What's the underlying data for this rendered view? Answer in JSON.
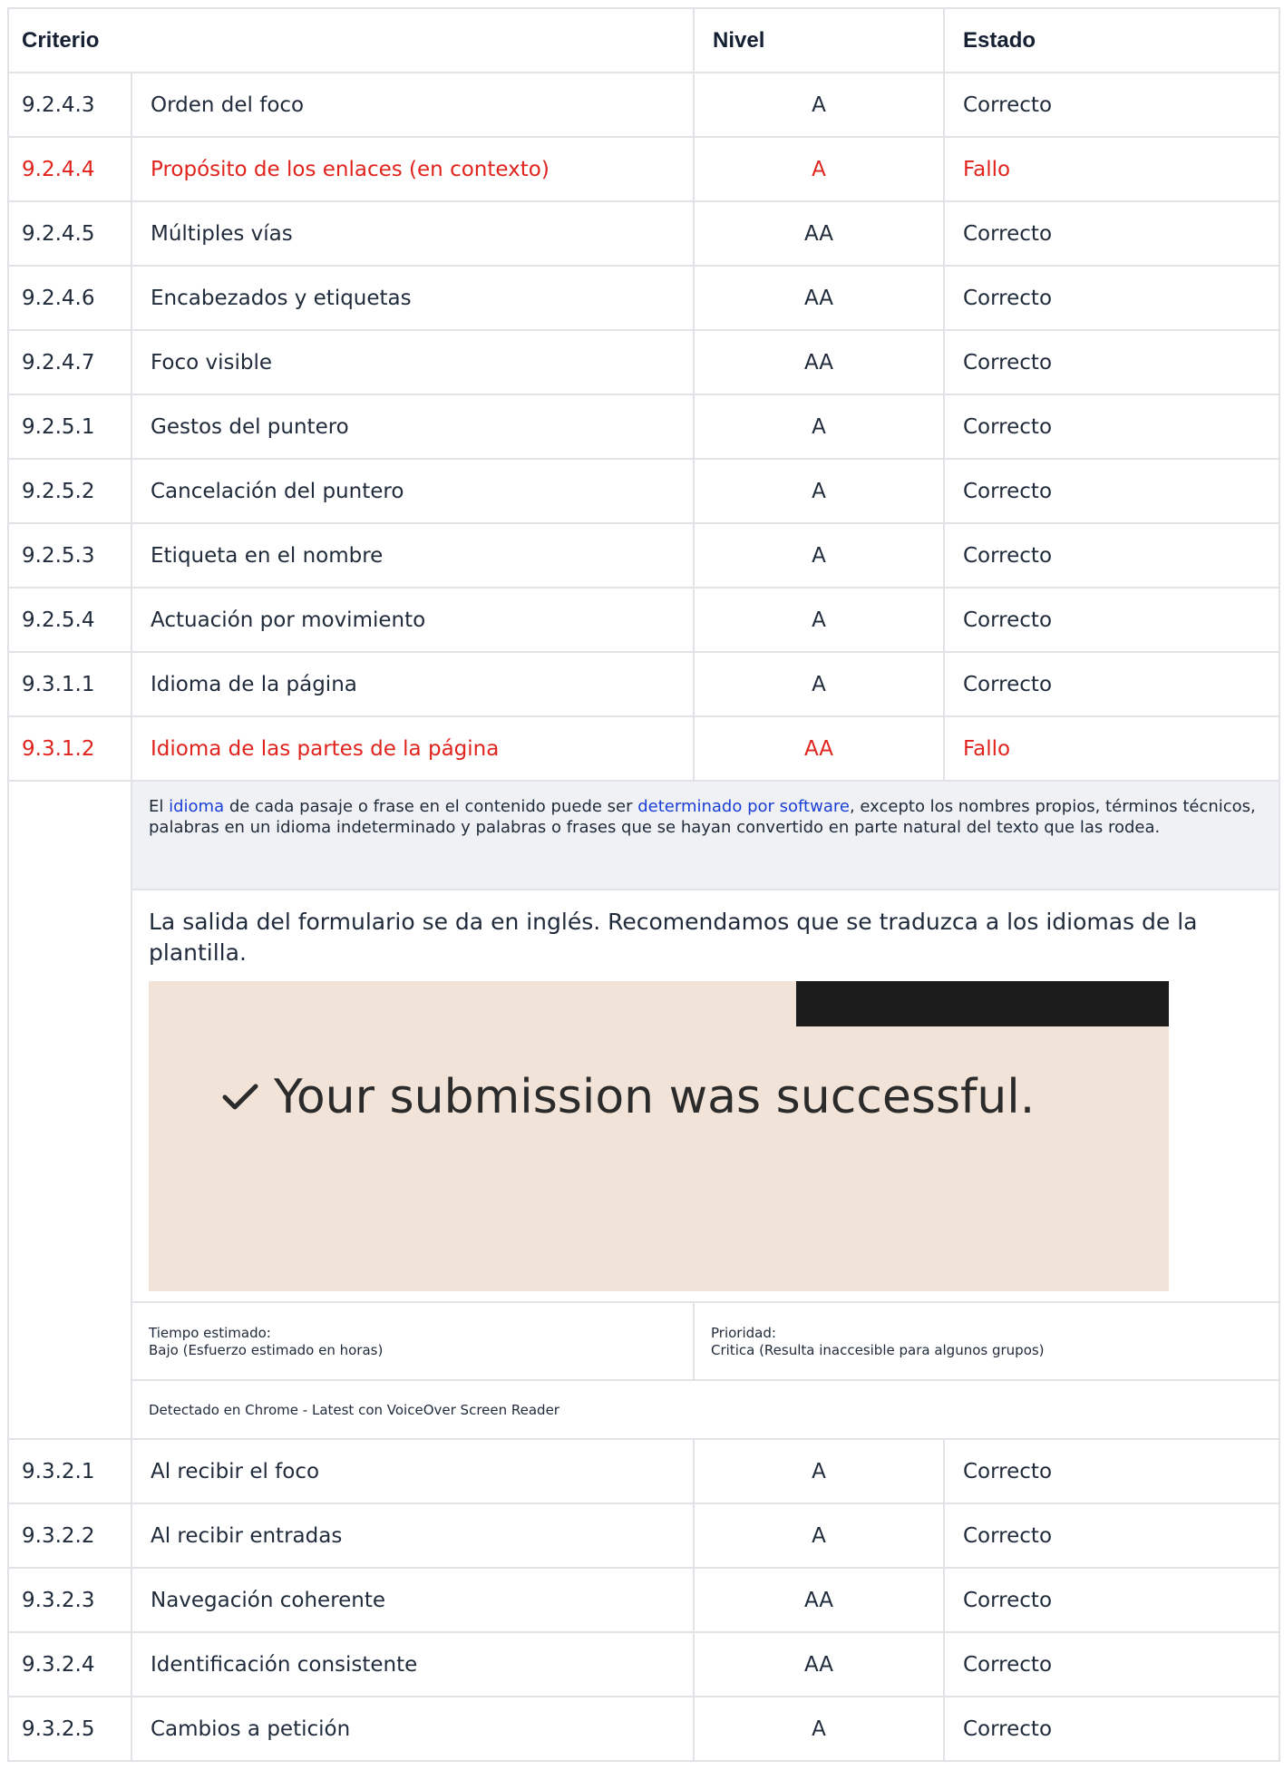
{
  "header": {
    "criterio": "Criterio",
    "nivel": "Nivel",
    "estado": "Estado"
  },
  "rows_top": [
    {
      "id": "9.2.4.3",
      "name": "Orden del foco",
      "level": "A",
      "state": "Correcto"
    },
    {
      "id": "9.2.4.4",
      "name": "Propósito de los enlaces (en contexto)",
      "level": "A",
      "state": "Fallo"
    },
    {
      "id": "9.2.4.5",
      "name": "Múltiples vías",
      "level": "AA",
      "state": "Correcto"
    },
    {
      "id": "9.2.4.6",
      "name": "Encabezados y etiquetas",
      "level": "AA",
      "state": "Correcto"
    },
    {
      "id": "9.2.4.7",
      "name": "Foco visible",
      "level": "AA",
      "state": "Correcto"
    },
    {
      "id": "9.2.5.1",
      "name": "Gestos del puntero",
      "level": "A",
      "state": "Correcto"
    },
    {
      "id": "9.2.5.2",
      "name": "Cancelación del puntero",
      "level": "A",
      "state": "Correcto"
    },
    {
      "id": "9.2.5.3",
      "name": "Etiqueta en el nombre",
      "level": "A",
      "state": "Correcto"
    },
    {
      "id": "9.2.5.4",
      "name": "Actuación por movimiento",
      "level": "A",
      "state": "Correcto"
    },
    {
      "id": "9.3.1.1",
      "name": "Idioma de la página",
      "level": "A",
      "state": "Correcto"
    },
    {
      "id": "9.3.1.2",
      "name": "Idioma de las partes de la página",
      "level": "AA",
      "state": "Fallo"
    }
  ],
  "detail": {
    "desc_prefix": "El ",
    "desc_link1": "idioma",
    "desc_mid": " de cada pasaje o frase en el contenido puede ser ",
    "desc_link2": "determinado por software",
    "desc_suffix": ", excepto los nombres propios, términos técnicos, palabras en un idioma indeterminado y palabras o frases que se hayan convertido en parte natural del texto que las rodea.",
    "finding": "La salida del formulario se da en inglés. Recomendamos que se traduzca a los idiomas de la plantilla.",
    "screenshot_text": "Your submission was successful.",
    "time_label": "Tiempo estimado:",
    "time_value": "Bajo (Esfuerzo estimado en horas)",
    "priority_label": "Prioridad:",
    "priority_value": "Critica (Resulta inaccesible para algunos grupos)",
    "detected": "Detectado en Chrome - Latest con VoiceOver Screen Reader"
  },
  "rows_bottom": [
    {
      "id": "9.3.2.1",
      "name": "Al recibir el foco",
      "level": "A",
      "state": "Correcto"
    },
    {
      "id": "9.3.2.2",
      "name": "Al recibir entradas",
      "level": "A",
      "state": "Correcto"
    },
    {
      "id": "9.3.2.3",
      "name": "Navegación coherente",
      "level": "AA",
      "state": "Correcto"
    },
    {
      "id": "9.3.2.4",
      "name": "Identificación consistente",
      "level": "AA",
      "state": "Correcto"
    },
    {
      "id": "9.3.2.5",
      "name": "Cambios a petición",
      "level": "A",
      "state": "Correcto"
    }
  ],
  "colors": {
    "fail": "#e0231c",
    "link": "#1a3fd6",
    "text": "#1f2a3a",
    "border": "#e1e3e6",
    "desc_bg": "#eff1f4",
    "screenshot_bg": "#f1e3d7"
  }
}
